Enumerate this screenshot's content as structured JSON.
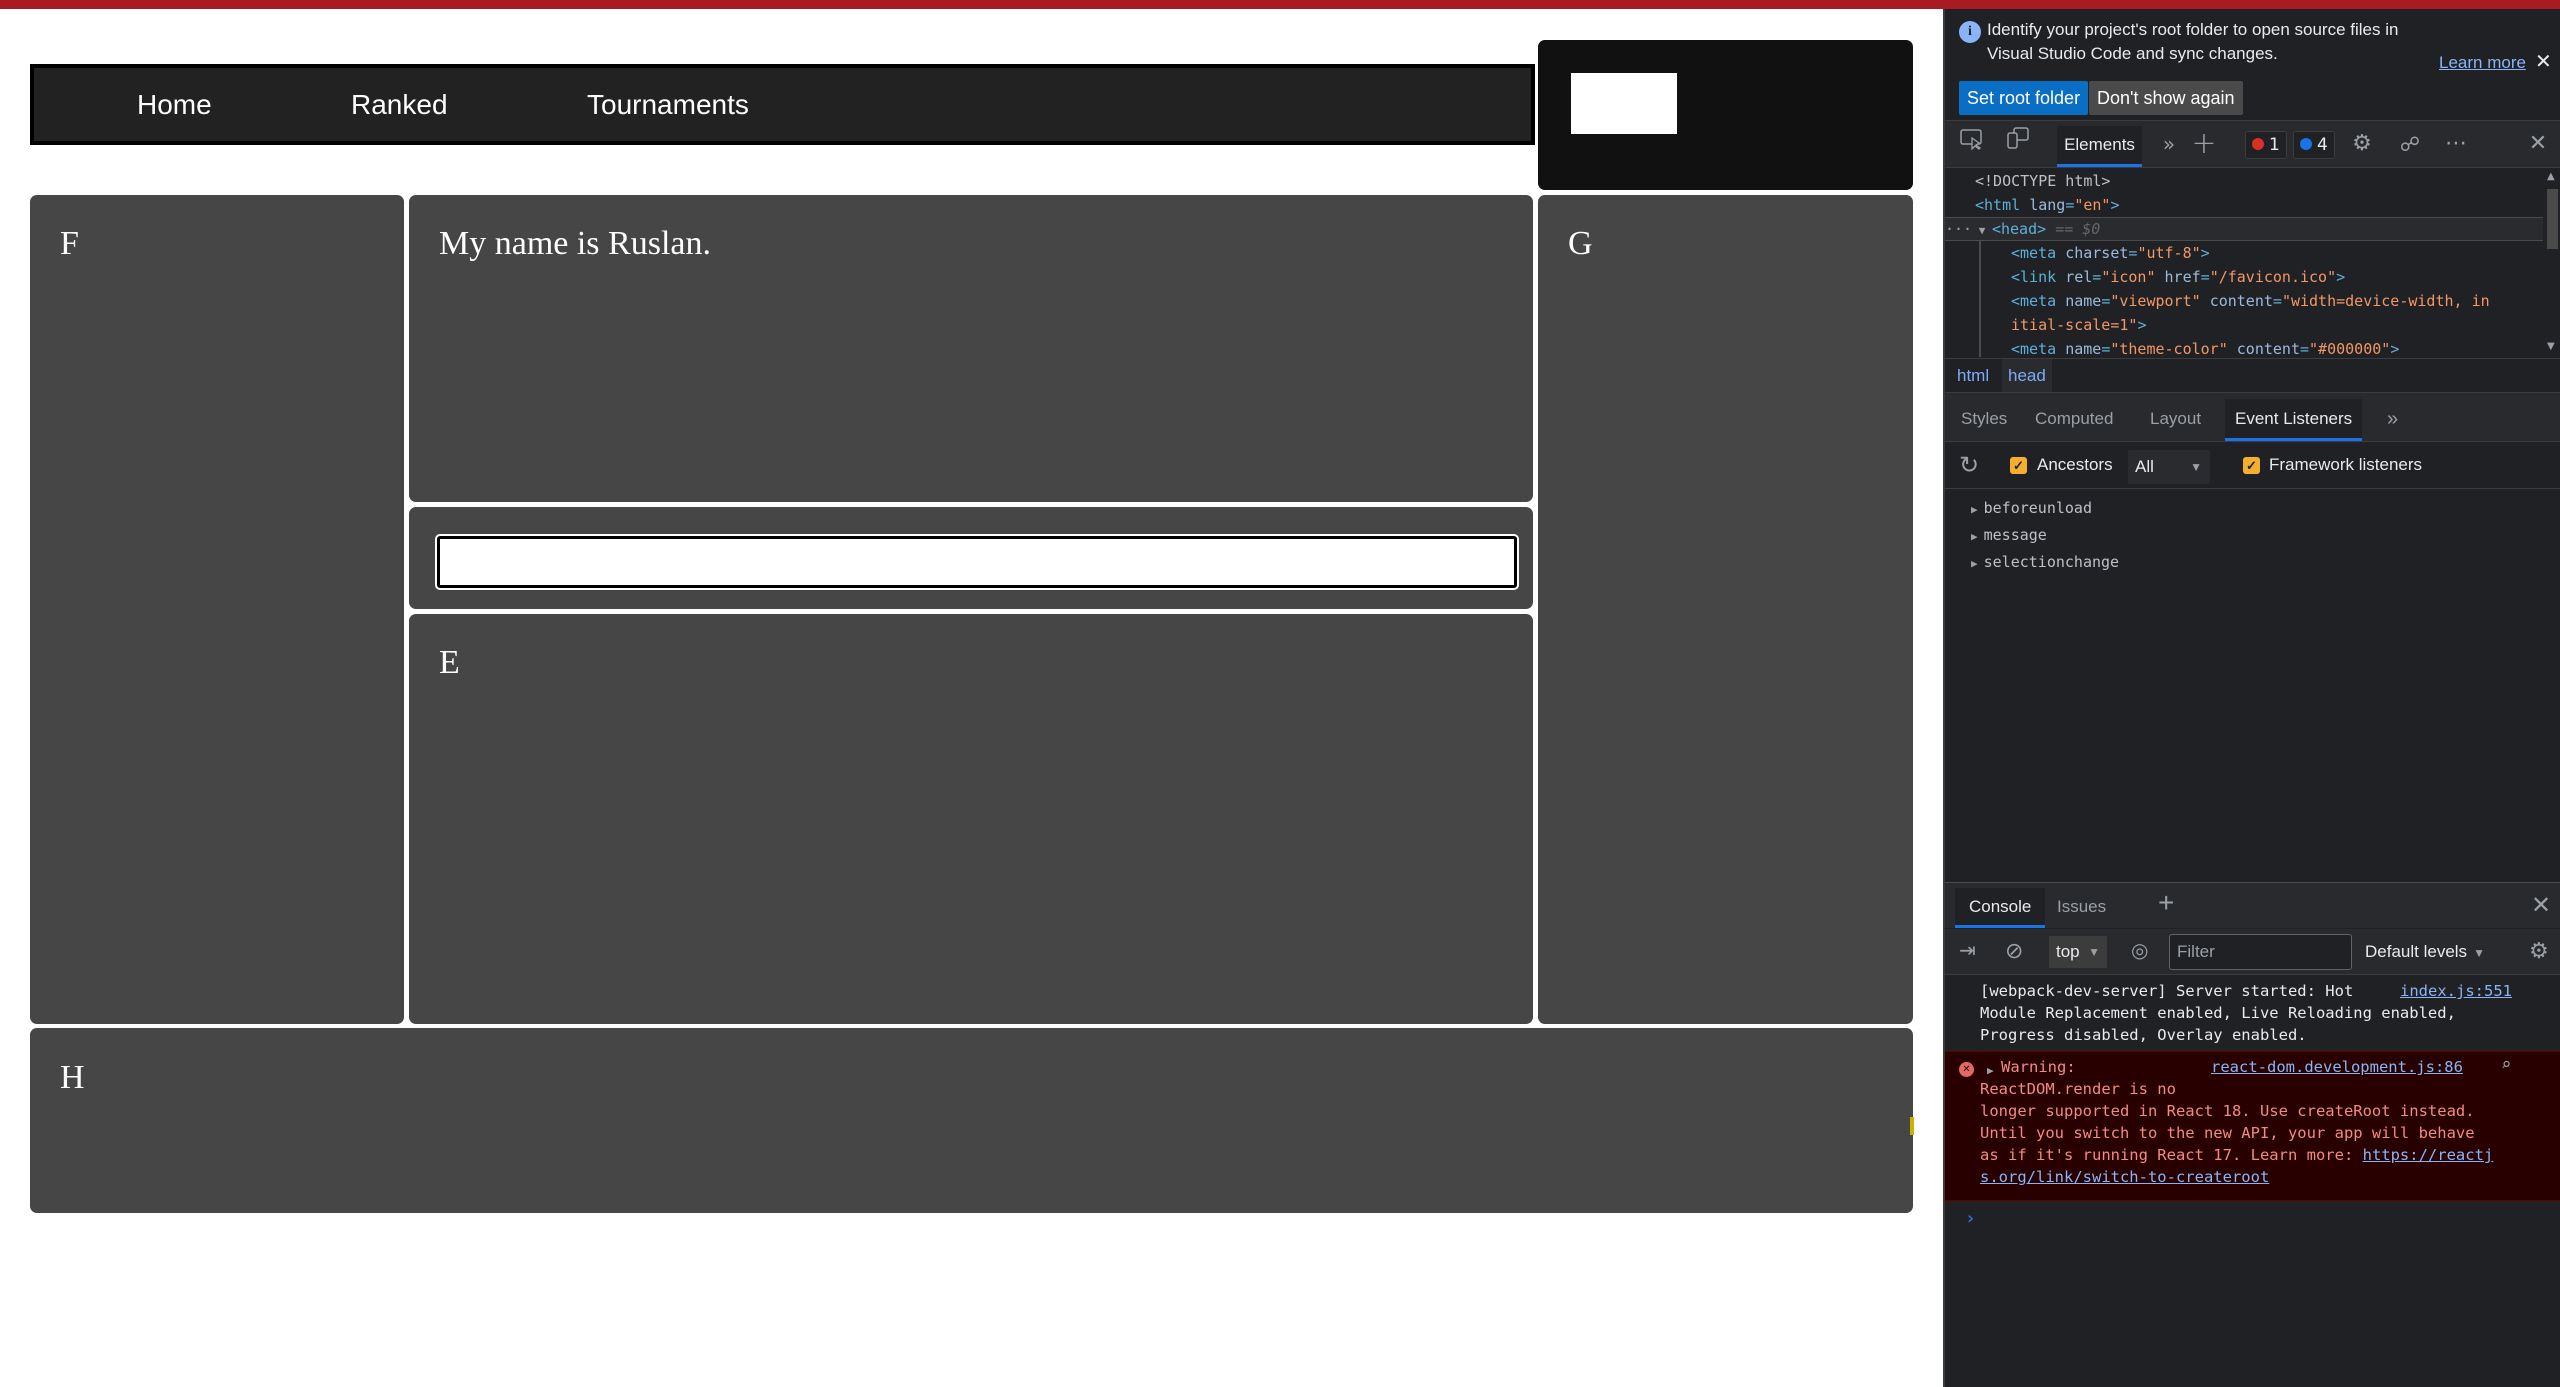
{
  "page": {
    "nav": {
      "items": [
        {
          "label": "Home"
        },
        {
          "label": "Ranked"
        },
        {
          "label": "Tournaments"
        }
      ]
    },
    "panels": {
      "left": {
        "label": "F"
      },
      "intro": {
        "text": "My name is Ruslan."
      },
      "input": {
        "value": "",
        "placeholder": ""
      },
      "center": {
        "label": "E"
      },
      "right": {
        "label": "G"
      },
      "footer": {
        "label": "H"
      }
    },
    "colors": {
      "topbar": "#aa1a23",
      "panel_bg": "#464646",
      "nav_bg": "#222222",
      "logo_bg": "#111111"
    }
  },
  "devtools": {
    "infobar": {
      "message": "Identify your project's root folder to open source files in Visual Studio Code and sync changes.",
      "learn_more": "Learn more",
      "set_root_folder": "Set root folder",
      "dont_show_again": "Don't show again"
    },
    "toolbar": {
      "active_tab": "Elements",
      "errors_count": "1",
      "issues_count": "4"
    },
    "dom_tree": {
      "lines": [
        "<!DOCTYPE html>",
        "<html lang=\"en\">",
        "<head>",
        "<meta charset=\"utf-8\">",
        "<link rel=\"icon\" href=\"/favicon.ico\">",
        "<meta name=\"viewport\" content=\"width=device-width, initial-scale=1\">",
        "<meta name=\"theme-color\" content=\"#000000\">"
      ],
      "selected_marker": "== $0"
    },
    "breadcrumbs": [
      "html",
      "head"
    ],
    "sub_tabs": [
      "Styles",
      "Computed",
      "Layout",
      "Event Listeners"
    ],
    "active_sub_tab": "Event Listeners",
    "event_listeners": {
      "ancestors_label": "Ancestors",
      "ancestors_checked": true,
      "filter_value": "All",
      "framework_label": "Framework listeners",
      "framework_checked": true,
      "items": [
        "beforeunload",
        "message",
        "selectionchange"
      ]
    },
    "console": {
      "tabs": [
        "Console",
        "Issues"
      ],
      "active_tab": "Console",
      "context": "top",
      "filter_placeholder": "Filter",
      "levels": "Default levels",
      "messages": [
        {
          "type": "info",
          "text": "[webpack-dev-server] Server started: Hot\nModule Replacement enabled, Live Reloading enabled,\nProgress disabled, Overlay enabled.",
          "source": "index.js:551"
        },
        {
          "type": "error",
          "head": "Warning:",
          "text": "ReactDOM.render is no\nlonger supported in React 18. Use createRoot instead.\nUntil you switch to the new API, your app will behave\nas if it's running React 17. Learn more: ",
          "link": "https://reactjs.org/link/switch-to-createroot",
          "link_line1": "https://reactj",
          "link_line2": "s.org/link/switch-to-createroot",
          "source": "react-dom.development.js:86"
        }
      ]
    }
  }
}
